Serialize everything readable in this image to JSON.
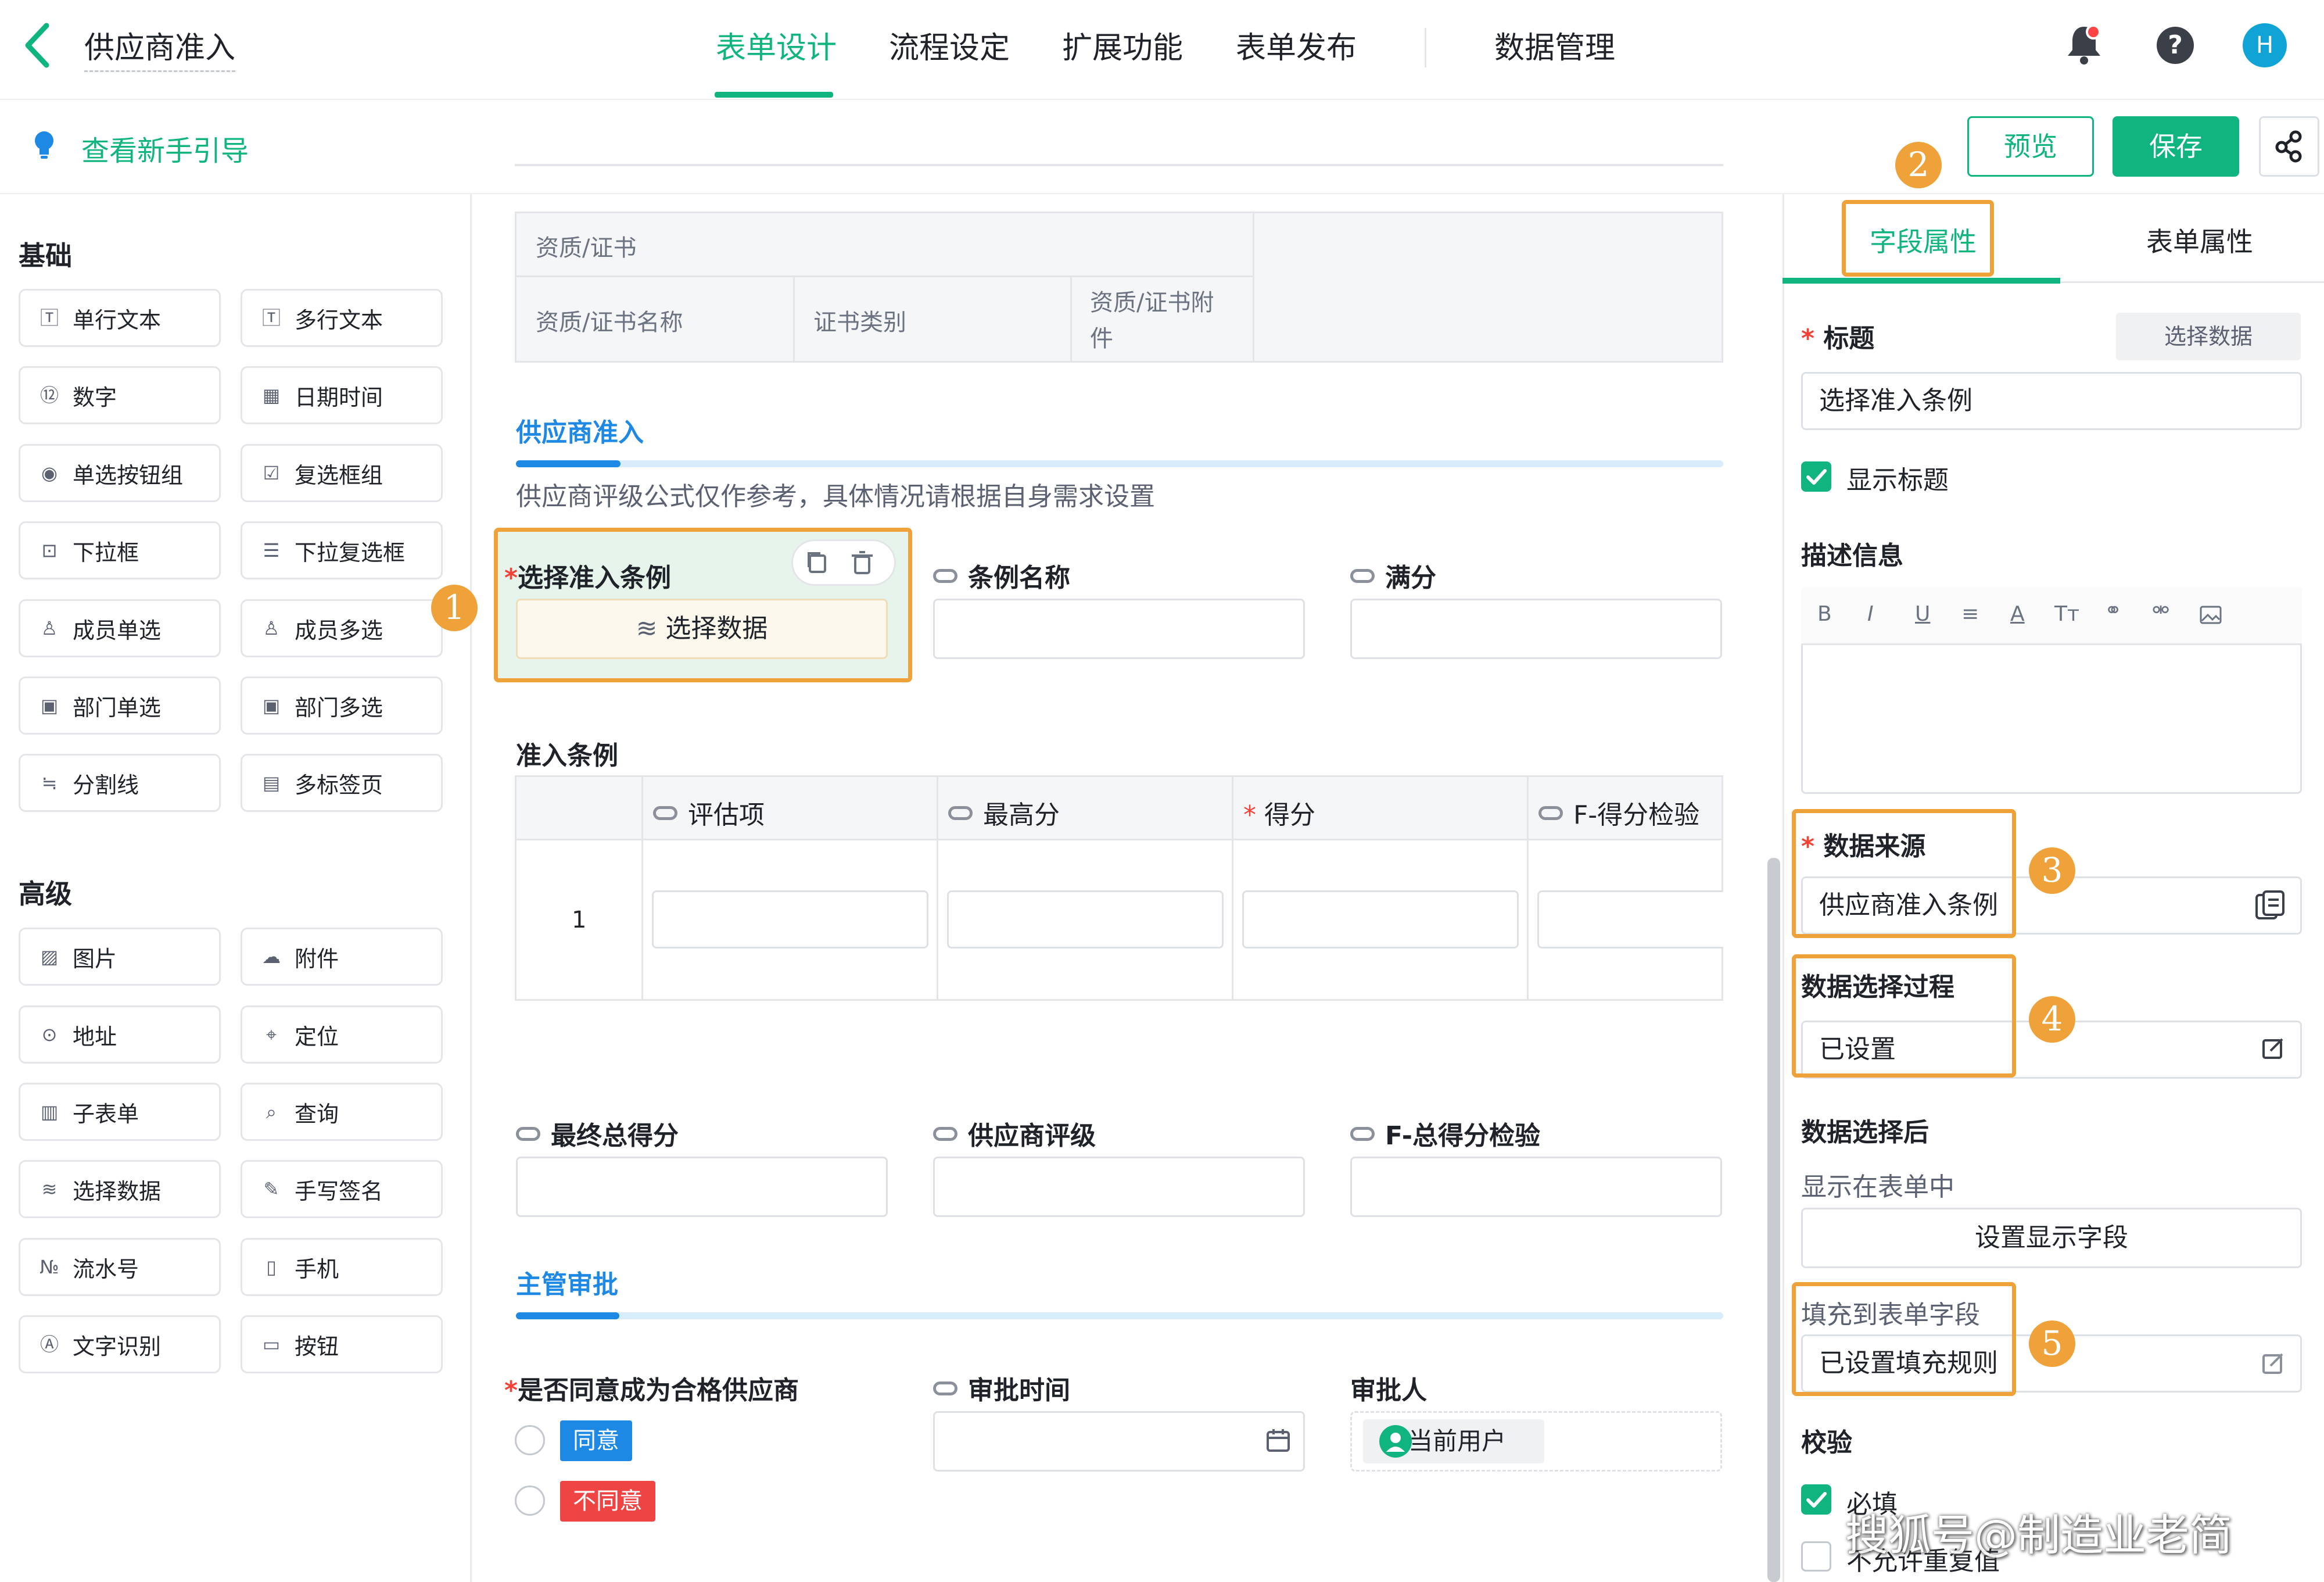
{
  "header": {
    "title": "供应商准入",
    "tabs": [
      {
        "label": "表单设计",
        "active": true
      },
      {
        "label": "流程设定"
      },
      {
        "label": "扩展功能"
      },
      {
        "label": "表单发布"
      },
      {
        "label": "数据管理"
      }
    ],
    "avatar": "H",
    "help": "?"
  },
  "subbar": {
    "guide": "查看新手引导",
    "preview": "预览",
    "save": "保存"
  },
  "left": {
    "basic_title": "基础",
    "basic": [
      "单行文本",
      "多行文本",
      "数字",
      "日期时间",
      "单选按钮组",
      "复选框组",
      "下拉框",
      "下拉复选框",
      "成员单选",
      "成员多选",
      "部门单选",
      "部门多选",
      "分割线",
      "多标签页"
    ],
    "advanced_title": "高级",
    "advanced": [
      "图片",
      "附件",
      "地址",
      "定位",
      "子表单",
      "查询",
      "选择数据",
      "手写签名",
      "流水号",
      "手机",
      "文字识别",
      "按钮"
    ]
  },
  "canvas": {
    "cert_table": {
      "title": "资质/证书",
      "cols": [
        "资质/证书名称",
        "证书类别",
        "资质/证书附件"
      ]
    },
    "section1": {
      "title": "供应商准入",
      "desc": "供应商评级公式仅作参考，具体情况请根据自身需求设置"
    },
    "select_field": {
      "label": "选择准入条例",
      "button": "选择数据"
    },
    "field_name": "条例名称",
    "field_full": "满分",
    "sub_title": "准入条例",
    "sub_cols": [
      "评估项",
      "最高分",
      "得分",
      "F-得分检验"
    ],
    "sub_row": "1",
    "field_total": "最终总得分",
    "field_rating": "供应商评级",
    "field_check": "F-总得分检验",
    "section2": {
      "title": "主管审批"
    },
    "approve_label": "是否同意成为合格供应商",
    "approve_options": [
      "同意",
      "不同意"
    ],
    "approve_time": "审批时间",
    "approver": "审批人",
    "approver_value": "当前用户"
  },
  "right": {
    "tabs": [
      "字段属性",
      "表单属性"
    ],
    "title_label": "标题",
    "select_data_btn": "选择数据",
    "title_value": "选择准入条例",
    "show_title": "显示标题",
    "desc_label": "描述信息",
    "rte_tools": [
      "B",
      "I",
      "U",
      "≡",
      "A",
      "Tт"
    ],
    "source_label": "数据来源",
    "source_value": "供应商准入条例",
    "process_label": "数据选择过程",
    "process_value": "已设置",
    "after_label": "数据选择后",
    "show_in_form": "显示在表单中",
    "set_display": "设置显示字段",
    "fill_label": "填充到表单字段",
    "fill_value": "已设置填充规则",
    "valid_label": "校验",
    "required": "必填",
    "no_dup": "不允许重复值"
  },
  "annotations": [
    "1",
    "2",
    "3",
    "4",
    "5"
  ],
  "watermark": "搜狐号@制造业老简",
  "colors": {
    "accent": "#10b47f",
    "section": "#1e88e5",
    "highlight": "#f0a23a",
    "danger": "#f44336"
  }
}
